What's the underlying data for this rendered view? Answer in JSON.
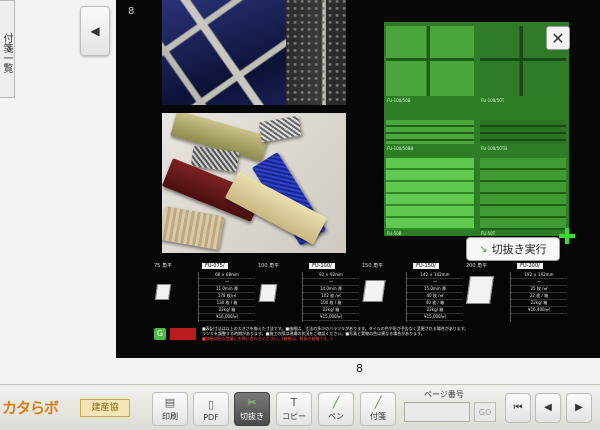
{
  "side_tab": {
    "label": "付箋一覧"
  },
  "prev_button": {
    "icon": "triangle-left-icon",
    "glyph": "◀"
  },
  "page": {
    "number_top": "8",
    "number_bottom": "8",
    "close_glyph": "✕",
    "cut_tooltip": {
      "icon": "cut-cursor-icon",
      "label": "切抜き実行"
    },
    "plus_glyph": "✚",
    "green_samples": [
      "FU-100/50B",
      "FU-100/50T",
      "FU-100/50BB",
      "FU-100/50TB",
      "FU-50B",
      "FU-50T"
    ],
    "specs": [
      {
        "title": "75 角平",
        "code": "FU-075/",
        "lines": [
          "68 × 68mm",
          "一",
          "11.0mm 厚",
          "178 枚/㎡",
          "130 枚 / 箱",
          "22kg/ 箱",
          "¥16,000/㎡"
        ]
      },
      {
        "title": "100 角平",
        "code": "FU-100/",
        "lines": [
          "92 × 92mm",
          "一",
          "14.0mm 厚",
          "102 枚 /㎡",
          "100 枚 / 箱",
          "22kg/ 箱",
          "¥15,000/㎡"
        ]
      },
      {
        "title": "150 角平",
        "code": "FU-150/",
        "lines": [
          "142 × 142mm",
          "一",
          "15.0mm 厚",
          "40 枚 /㎡",
          "40 枚 / 箱",
          "22kg/ 箱",
          "¥15,000/㎡"
        ]
      },
      {
        "title": "200 角平",
        "code": "FU-200/",
        "lines": [
          "192 × 192mm",
          "一",
          "25 枚 /㎡",
          "22 枚 / 箱",
          "22kg/ 箱",
          "¥16,400/㎡"
        ]
      }
    ],
    "footnote_lines": [
      "■表記寸法は以上の大きさを揃えた寸法です。■価格は、寸法の多少のバラツキがあります。タイルの色や形が予告なく変更される場合があります。",
      "ラツキを調整する時期があります。■施工の際は現場の状況をご確認ください。■写真と実物の色は異なる場合があります。"
    ],
    "footnote_red": "■詳細は担当営業にお問い合わせください。(価格は、税抜き価格です。)"
  },
  "toolbar": {
    "brand": "カタらボ",
    "brand_badge": "建産協",
    "buttons": [
      {
        "key": "print",
        "label": "印刷",
        "icon": "printer-icon",
        "glyph": "▤"
      },
      {
        "key": "pdf",
        "label": "PDF",
        "icon": "pdf-icon",
        "glyph": "▯"
      },
      {
        "key": "cut",
        "label": "切抜き",
        "icon": "scissors-icon",
        "glyph": "✂"
      },
      {
        "key": "copy",
        "label": "コピー",
        "icon": "text-copy-icon",
        "glyph": "T"
      },
      {
        "key": "pen",
        "label": "ペン",
        "icon": "pen-icon",
        "glyph": "╱"
      },
      {
        "key": "sticky",
        "label": "付箋",
        "icon": "sticky-note-icon",
        "glyph": "╱"
      }
    ],
    "page_number_label": "ページ番号",
    "page_input_value": "",
    "go_label": "GO",
    "nav": [
      {
        "key": "first",
        "glyph": "⏮"
      },
      {
        "key": "prev",
        "glyph": "◀"
      },
      {
        "key": "next",
        "glyph": "▶"
      }
    ]
  },
  "colors": {
    "accent_green": "#43d535",
    "brand_orange": "#d47f16"
  }
}
